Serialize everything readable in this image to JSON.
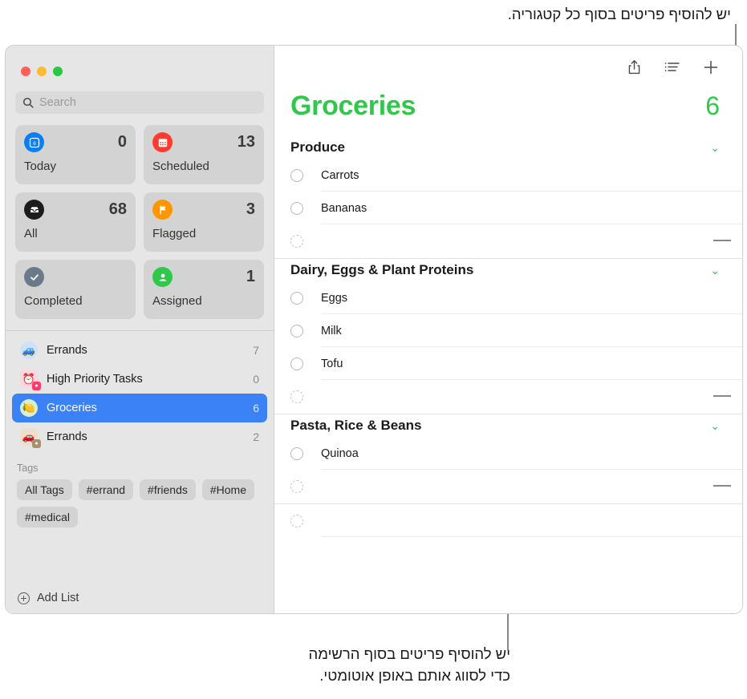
{
  "annotations": {
    "top_callout": "יש להוסיף פריטים בסוף כל קטגוריה.",
    "bottom_callout_line1": "יש להוסיף פריטים בסוף הרשימה",
    "bottom_callout_line2": "כדי לסווג אותם באופן אוטומטי."
  },
  "window": {
    "traffic_lights": [
      "close",
      "minimize",
      "zoom"
    ]
  },
  "sidebar": {
    "search": {
      "placeholder": "Search",
      "value": "",
      "icon": "search-icon"
    },
    "smart_lists": [
      {
        "label": "Today",
        "count": "0",
        "icon": "calendar-day-icon",
        "color": "#0a7ef5",
        "glyph": "6"
      },
      {
        "label": "Scheduled",
        "count": "13",
        "icon": "calendar-icon",
        "color": "#ff3b30",
        "glyph": "▦"
      },
      {
        "label": "All",
        "count": "68",
        "icon": "inbox-tray-icon",
        "color": "#1c1c1e",
        "glyph": "▭"
      },
      {
        "label": "Flagged",
        "count": "3",
        "icon": "flag-icon",
        "color": "#ff9500",
        "glyph": "⚑"
      },
      {
        "label": "Completed",
        "count": "",
        "icon": "checkmark-icon",
        "color": "#6b7a8b",
        "glyph": "✓"
      },
      {
        "label": "Assigned",
        "count": "1",
        "icon": "person-icon",
        "color": "#2fc84a",
        "glyph": "👤"
      }
    ],
    "lists": [
      {
        "name": "Errands",
        "count": "7",
        "emoji": "🚙",
        "bg": "#cfe1f7",
        "shape": "circle",
        "shared": false,
        "selected": false
      },
      {
        "name": "High Priority Tasks",
        "count": "0",
        "emoji": "⏰",
        "bg": "#fbd6e0",
        "shape": "square",
        "shared": true,
        "badge_color": "#ff3b6b",
        "selected": false
      },
      {
        "name": "Groceries",
        "count": "6",
        "emoji": "🍋",
        "bg": "#d8f0cf",
        "shape": "circle",
        "shared": false,
        "selected": true
      },
      {
        "name": "Errands",
        "count": "2",
        "emoji": "🚗",
        "bg": "#ece0cd",
        "shape": "square",
        "shared": true,
        "badge_color": "#a89072",
        "selected": false
      }
    ],
    "tags_title": "Tags",
    "tags": [
      "All Tags",
      "#errand",
      "#friends",
      "#Home",
      "#medical"
    ],
    "add_list_label": "Add List"
  },
  "content": {
    "toolbar": [
      {
        "name": "share-icon",
        "label": "Share"
      },
      {
        "name": "list-options-icon",
        "label": "List Options"
      },
      {
        "name": "add-reminder-icon",
        "label": "Add Reminder"
      }
    ],
    "title": "Groceries",
    "total": "6",
    "accent_color": "#2fc84a",
    "groups": [
      {
        "title": "Produce",
        "chevron": "⌄",
        "items": [
          {
            "text": "Carrots",
            "completed": false
          },
          {
            "text": "Bananas",
            "completed": false
          }
        ],
        "empty_row": true
      },
      {
        "title": "Dairy, Eggs & Plant Proteins",
        "chevron": "⌄",
        "items": [
          {
            "text": "Eggs",
            "completed": false
          },
          {
            "text": "Milk",
            "completed": false
          },
          {
            "text": "Tofu",
            "completed": false
          }
        ],
        "empty_row": true
      },
      {
        "title": "Pasta, Rice & Beans",
        "chevron": "⌄",
        "items": [
          {
            "text": "Quinoa",
            "completed": false
          }
        ],
        "empty_row": true
      }
    ],
    "trailing_empty_row": true
  }
}
